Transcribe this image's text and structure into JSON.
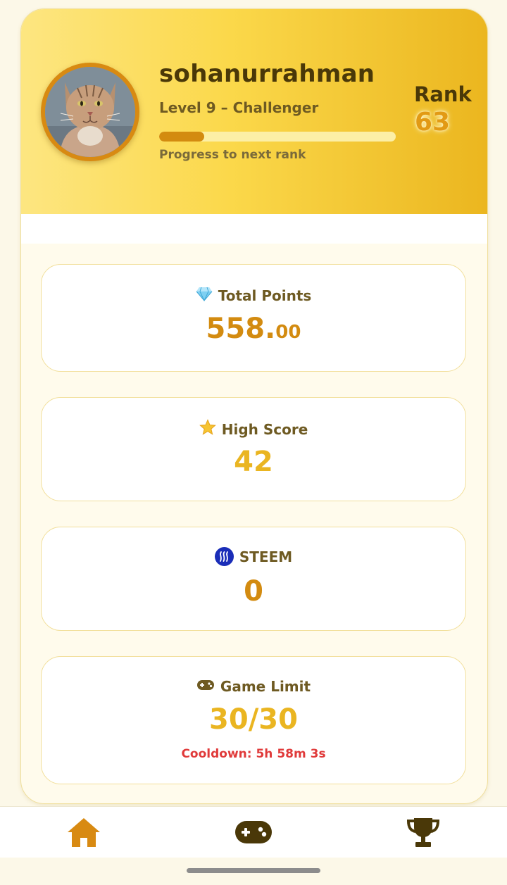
{
  "profile": {
    "username": "sohanurrahman",
    "level_text": "Level 9 – Challenger",
    "progress_label": "Progress to next rank",
    "progress_fraction": 0.19,
    "rank_label": "Rank",
    "rank_value": "63"
  },
  "stats": {
    "total_points": {
      "icon": "gem-icon",
      "label": "Total Points",
      "value_int": "558.",
      "value_dec": "00"
    },
    "high_score": {
      "icon": "star-icon",
      "label": "High Score",
      "value": "42"
    },
    "steem": {
      "icon": "steem-icon",
      "label": "STEEM",
      "value": "0"
    },
    "game_limit": {
      "icon": "gamepad-icon",
      "label": "Game Limit",
      "value": "30/30",
      "cooldown": "Cooldown: 5h 58m 3s"
    }
  },
  "nav": {
    "items": [
      "home-icon",
      "gamepad-icon",
      "trophy-icon"
    ]
  },
  "colors": {
    "accent_orange": "#d38b10",
    "accent_yellow": "#eab521",
    "cooldown_red": "#e03a3a",
    "text_dark": "#4a3808"
  }
}
